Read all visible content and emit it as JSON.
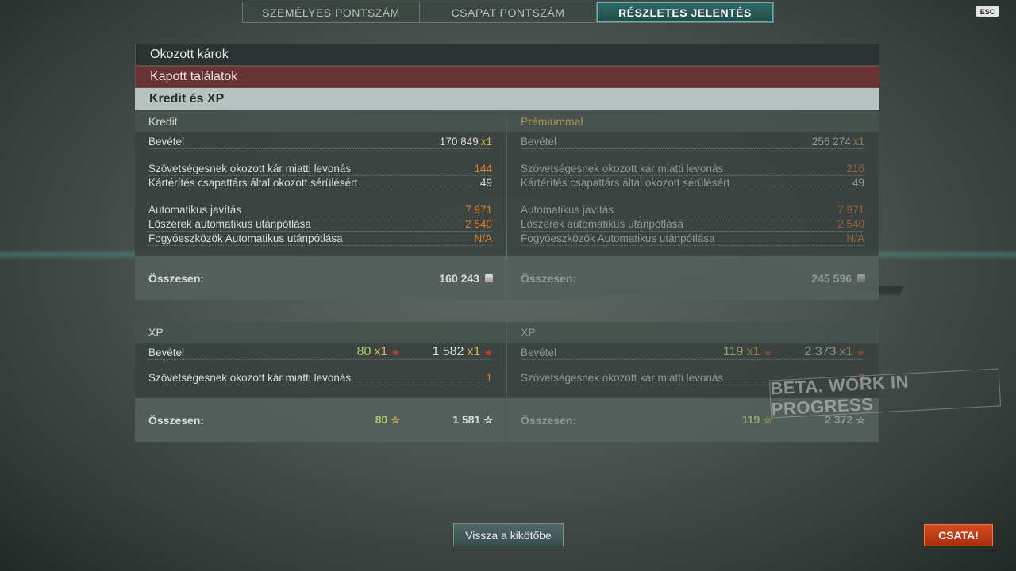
{
  "tabs": [
    {
      "label": "SZEMÉLYES PONTSZÁM"
    },
    {
      "label": "CSAPAT PONTSZÁM"
    },
    {
      "label": "RÉSZLETES JELENTÉS"
    }
  ],
  "esc_label": "ESC",
  "sections": {
    "damage": "Okozott károk",
    "hits": "Kapott találatok",
    "credit_xp": "Kredit és XP"
  },
  "credit": {
    "title": "Kredit",
    "income_label": "Bevétel",
    "income_value": "170 849",
    "income_mult": "x1",
    "ally_damage_label": "Szövetségesnek okozott kár miatti levonás",
    "ally_damage_value": "144",
    "compensation_label": "Kártérítés csapattárs által okozott sérülésért",
    "compensation_value": "49",
    "repair_label": "Automatikus javítás",
    "repair_value": "7 971",
    "ammo_label": "Lőszerek automatikus utánpótlása",
    "ammo_value": "2 540",
    "consumables_label": "Fogyóeszközök Automatikus utánpótlása",
    "consumables_value": "N/A",
    "total_label": "Összesen:",
    "total_value": "160 243"
  },
  "premium": {
    "title": "Prémiummal",
    "income_label": "Bevétel",
    "income_value": "256 274",
    "income_mult": "x1",
    "ally_damage_label": "Szövetségesnek okozott kár miatti levonás",
    "ally_damage_value": "216",
    "compensation_label": "Kártérítés csapattárs által okozott sérülésért",
    "compensation_value": "49",
    "repair_label": "Automatikus javítás",
    "repair_value": "7 971",
    "ammo_label": "Lőszerek automatikus utánpótlása",
    "ammo_value": "2 540",
    "consumables_label": "Fogyóeszközök Automatikus utánpótlása",
    "consumables_value": "N/A",
    "total_label": "Összesen:",
    "total_value": "245 596"
  },
  "xp": {
    "title": "XP",
    "income_label": "Bevétel",
    "ship_xp": "80",
    "ship_mult": "x1",
    "captain_xp": "1 582",
    "captain_mult": "x1",
    "ally_damage_label": "Szövetségesnek okozott kár miatti levonás",
    "ally_damage_value": "1",
    "total_label": "Összesen:",
    "total_ship": "80",
    "total_captain": "1 581"
  },
  "xp_premium": {
    "title": "XP",
    "income_label": "Bevétel",
    "ship_xp": "119",
    "ship_mult": "x1",
    "captain_xp": "2 373",
    "captain_mult": "x1",
    "ally_damage_label": "Szövetségesnek okozott kár miatti levonás",
    "ally_damage_value": "2",
    "total_label": "Összesen:",
    "total_ship": "119",
    "total_captain": "2 372"
  },
  "watermark": "BETA. WORK IN PROGRESS",
  "buttons": {
    "back": "Vissza a kikötőbe",
    "battle": "CSATA!"
  },
  "icons": {
    "credit": "credit-coin-icon",
    "xp_bonus": "red-star-icon",
    "ship_xp": "gold-star-icon",
    "captain_xp": "white-star-icon"
  },
  "colors": {
    "accent_teal": "#2f6a66",
    "hits_bar": "#6a3333",
    "battle_button": "#d94a1e",
    "negative": "#e07a2a",
    "ship_xp": "#a9cf6a"
  }
}
